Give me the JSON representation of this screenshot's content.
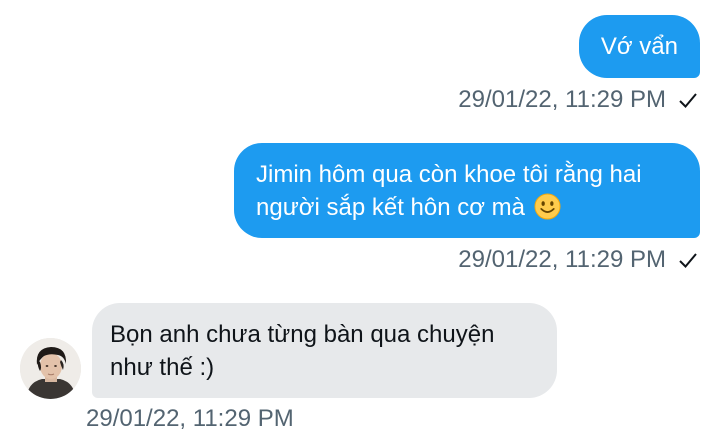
{
  "messages": [
    {
      "direction": "outgoing",
      "text": "Vớ vẩn",
      "timestamp": "29/01/22, 11:29 PM",
      "status_icon": "check-icon"
    },
    {
      "direction": "outgoing",
      "text": "Jimin hôm qua còn khoe tôi rằng hai người sắp kết hôn cơ mà",
      "emoji": "slightly-smiling-face-emoji",
      "timestamp": "29/01/22, 11:29 PM",
      "status_icon": "check-icon"
    },
    {
      "direction": "incoming",
      "text": "Bọn anh chưa từng bàn qua chuyện như thế :)",
      "timestamp": "29/01/22, 11:29 PM",
      "avatar_icon": "user-avatar"
    }
  ],
  "colors": {
    "outgoing_bubble": "#1d9bf0",
    "incoming_bubble": "#e7e9eb",
    "timestamp_text": "#536471",
    "outgoing_text": "#ffffff",
    "incoming_text": "#0f1419"
  }
}
